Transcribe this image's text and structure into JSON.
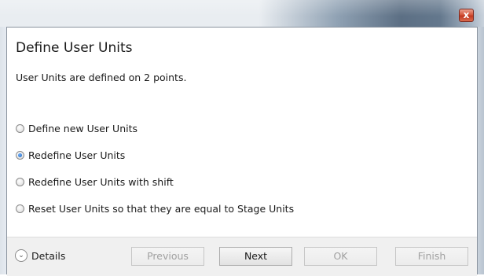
{
  "window": {
    "close_glyph": "x"
  },
  "dialog": {
    "title": "Define User Units",
    "subtitle": "User Units are defined on 2 points.",
    "options": [
      {
        "label": "Define new User Units",
        "checked": false
      },
      {
        "label": "Redefine User Units",
        "checked": true
      },
      {
        "label": "Redefine User Units with shift",
        "checked": false
      },
      {
        "label": "Reset User Units so that they are equal to Stage Units",
        "checked": false
      }
    ]
  },
  "footer": {
    "details_label": "Details",
    "details_icon": "chevron-down-icon",
    "buttons": {
      "previous": {
        "label": "Previous",
        "enabled": false
      },
      "next": {
        "label": "Next",
        "enabled": true
      },
      "ok": {
        "label": "OK",
        "enabled": false
      },
      "finish": {
        "label": "Finish",
        "enabled": false
      }
    }
  }
}
